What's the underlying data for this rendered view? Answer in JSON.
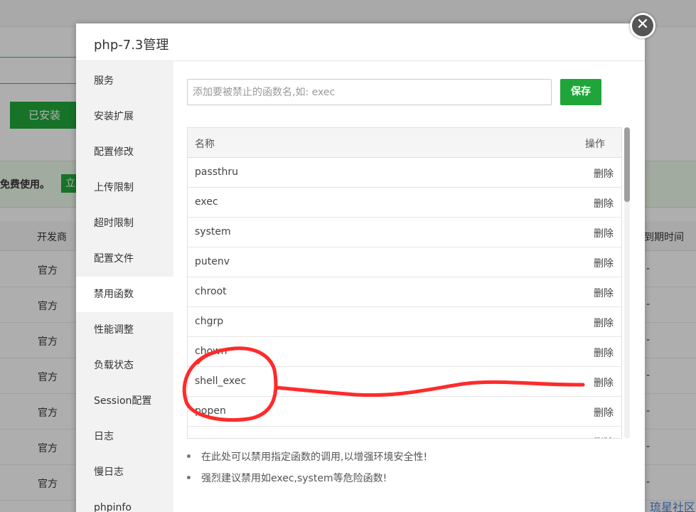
{
  "background": {
    "installed_label": "已安装",
    "free_text": "免费使用。",
    "free_button_fragment": "立",
    "col_developer": "开发商",
    "col_expiry": "到期时间",
    "rows": [
      {
        "developer": "官方",
        "expiry": "-"
      },
      {
        "developer": "官方",
        "expiry": "-"
      },
      {
        "developer": "官方",
        "expiry": "-"
      },
      {
        "developer": "官方",
        "expiry": "-"
      },
      {
        "developer": "官方",
        "expiry": "-"
      },
      {
        "developer": "官方",
        "expiry": "-"
      },
      {
        "developer": "官方",
        "expiry": "-"
      }
    ],
    "watermark": "琉星社区"
  },
  "dialog": {
    "title": "php-7.3管理",
    "close_icon": "close-icon"
  },
  "sidebar": {
    "active_index": 6,
    "items": [
      {
        "label": "服务"
      },
      {
        "label": "安装扩展"
      },
      {
        "label": "配置修改"
      },
      {
        "label": "上传限制"
      },
      {
        "label": "超时限制"
      },
      {
        "label": "配置文件"
      },
      {
        "label": "禁用函数"
      },
      {
        "label": "性能调整"
      },
      {
        "label": "负载状态"
      },
      {
        "label": "Session配置"
      },
      {
        "label": "日志"
      },
      {
        "label": "慢日志"
      },
      {
        "label": "phpinfo"
      }
    ]
  },
  "form": {
    "input_value": "",
    "input_placeholder": "添加要被禁止的函数名,如: exec",
    "save_label": "保存"
  },
  "table": {
    "col_name": "名称",
    "col_action": "操作",
    "rows": [
      {
        "name": "passthru",
        "action": "删除"
      },
      {
        "name": "exec",
        "action": "删除"
      },
      {
        "name": "system",
        "action": "删除"
      },
      {
        "name": "putenv",
        "action": "删除"
      },
      {
        "name": "chroot",
        "action": "删除"
      },
      {
        "name": "chgrp",
        "action": "删除"
      },
      {
        "name": "chown",
        "action": "删除"
      },
      {
        "name": "shell_exec",
        "action": "删除"
      },
      {
        "name": "popen",
        "action": "删除"
      },
      {
        "name": "",
        "action": "删除"
      }
    ]
  },
  "tips": [
    "在此处可以禁用指定函数的调用,以增强环境安全性!",
    "强烈建议禁用如exec,system等危险函数!"
  ],
  "colors": {
    "accent": "#20a53a",
    "annotation": "#ff2a2a"
  }
}
